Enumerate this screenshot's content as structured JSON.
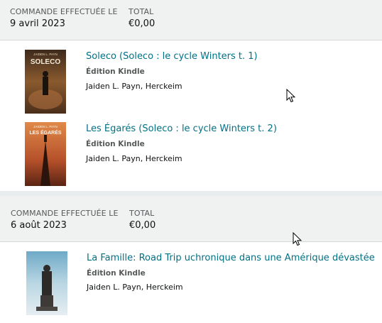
{
  "orders": [
    {
      "date_label": "COMMANDE EFFECTUÉE LE",
      "date": "9 avril 2023",
      "total_label": "TOTAL",
      "total": "€0,00",
      "items": [
        {
          "title": "Soleco (Soleco : le cycle Winters t. 1)",
          "format": "Édition Kindle",
          "authors": "Jaiden L. Payn, Herckeim",
          "cover_author": "JAIDEN L. PAYN",
          "cover_title": "SOLECO"
        },
        {
          "title": "Les Égarés (Soleco : le cycle Winters t. 2)",
          "format": "Édition Kindle",
          "authors": "Jaiden L. Payn, Herckeim",
          "cover_author": "JAIDEN L. PAYN",
          "cover_title": "LES ÉGARÉS"
        }
      ]
    },
    {
      "date_label": "COMMANDE EFFECTUÉE LE",
      "date": "6 août 2023",
      "total_label": "TOTAL",
      "total": "€0,00",
      "items": [
        {
          "title": "La Famille: Road Trip uchronique dans une Amérique dévastée",
          "format": "Édition Kindle",
          "authors": "Jaiden L. Payn, Herckeim"
        }
      ]
    }
  ],
  "colors": {
    "link": "#007185",
    "header_bg": "#f0f2f2",
    "label": "#565959"
  },
  "icons": {
    "cursor": "mouse-pointer-icon"
  }
}
